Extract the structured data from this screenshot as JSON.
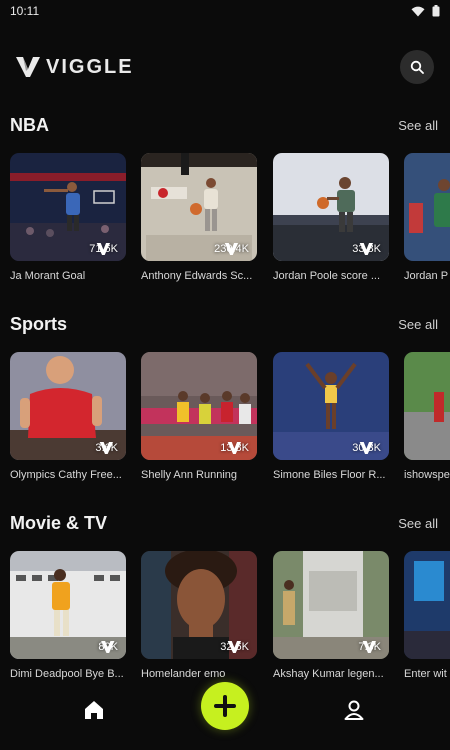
{
  "status": {
    "time": "10:11"
  },
  "brand": {
    "name": "VIGGLE"
  },
  "colors": {
    "accent": "#c6f01f",
    "background": "#0b0b0b"
  },
  "sections": [
    {
      "title": "NBA",
      "see_all": "See all",
      "cards": [
        {
          "title": "Ja Morant Goal",
          "count": "71.6K"
        },
        {
          "title": "Anthony Edwards Sc...",
          "count": "230.4K"
        },
        {
          "title": "Jordan Poole score ...",
          "count": "33.8K"
        },
        {
          "title": "Jordan P",
          "count": ""
        }
      ]
    },
    {
      "title": "Sports",
      "see_all": "See all",
      "cards": [
        {
          "title": "Olympics Cathy Free...",
          "count": "3.6K"
        },
        {
          "title": "Shelly Ann Running",
          "count": "13.8K"
        },
        {
          "title": "Simone Biles Floor R...",
          "count": "30.3K"
        },
        {
          "title": "ishowspe",
          "count": ""
        }
      ]
    },
    {
      "title": "Movie & TV",
      "see_all": "See all",
      "cards": [
        {
          "title": "Dimi Deadpool Bye B...",
          "count": "89K"
        },
        {
          "title": "Homelander emo",
          "count": "32.6K"
        },
        {
          "title": "Akshay Kumar legen...",
          "count": "7.3K"
        },
        {
          "title": "Enter wit",
          "count": ""
        }
      ]
    }
  ],
  "nav": {
    "home_icon": "home-icon",
    "add_icon": "plus-icon",
    "profile_icon": "profile-icon"
  }
}
